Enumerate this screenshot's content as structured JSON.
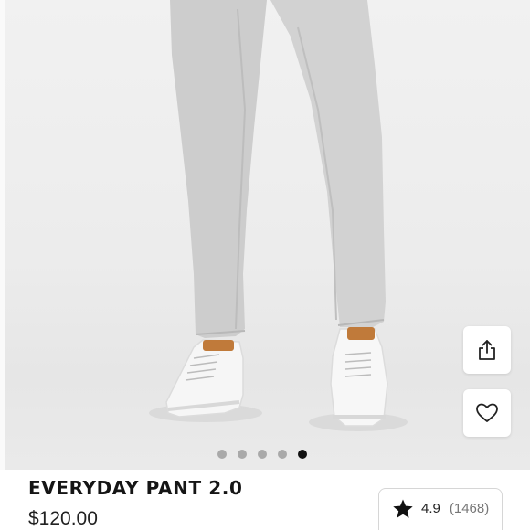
{
  "product": {
    "title": "EVERYDAY PANT 2.0",
    "price": "$120.00",
    "image_alt": "Model wearing light grey pants and white sneakers"
  },
  "gallery": {
    "total_images": 5,
    "active_index": 4
  },
  "actions": {
    "share_icon": "share-icon",
    "wishlist_icon": "heart-icon"
  },
  "rating": {
    "icon": "star-icon",
    "value": "4.9",
    "count": "(1468)"
  },
  "colors": {
    "pant": "#cfcfcf",
    "sneaker": "#f7f7f7",
    "heel_tab": "#c07a3a",
    "active_dot": "#111111",
    "inactive_dot": "#a9a9a9"
  }
}
